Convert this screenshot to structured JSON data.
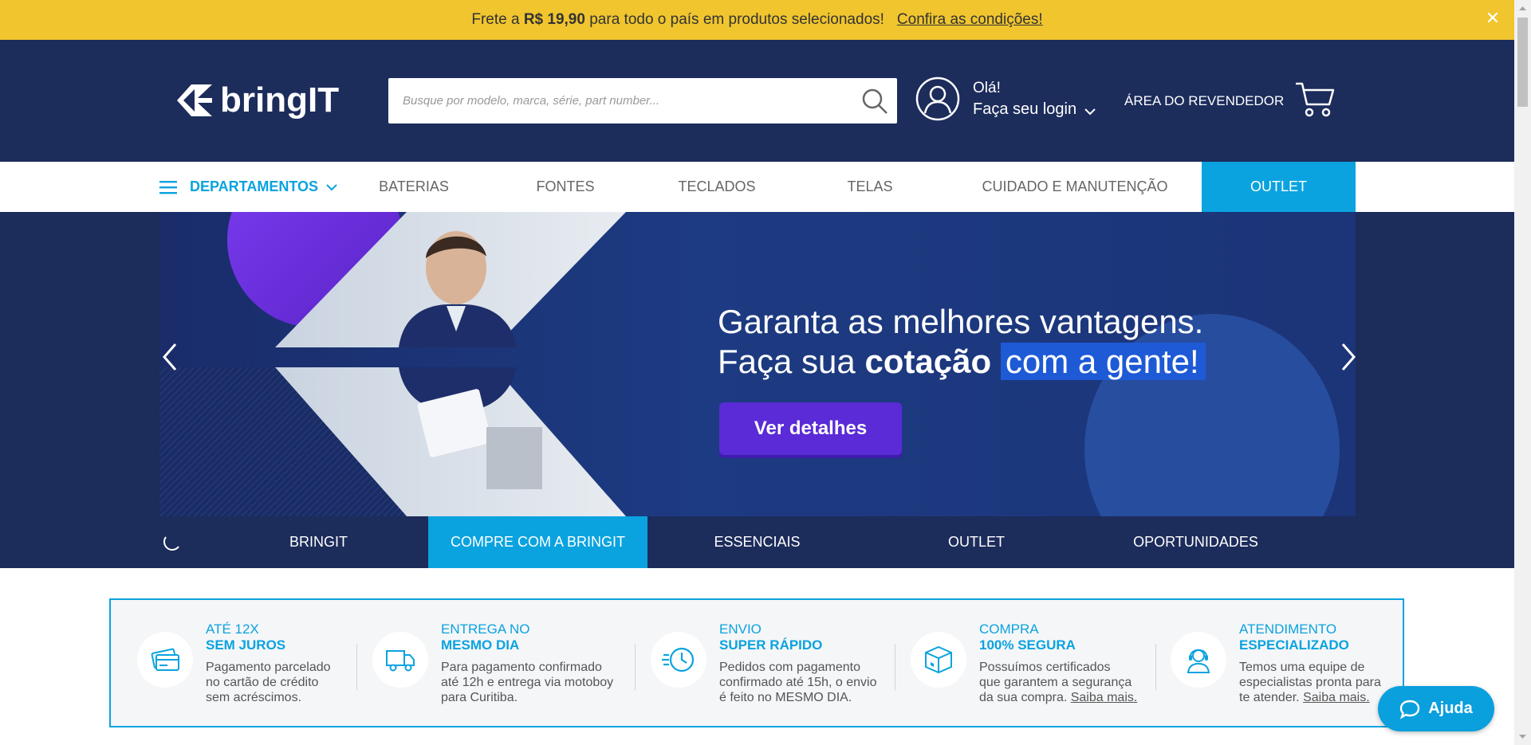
{
  "promo": {
    "text_prefix": "Frete a ",
    "price": "R$ 19,90",
    "text_suffix": " para todo o país em produtos selecionados!",
    "link": "Confira as condições!",
    "close_label": "✕"
  },
  "header": {
    "logo": "bringIT",
    "search_placeholder": "Busque por modelo, marca, série, part number...",
    "greeting": "Olá!",
    "login": "Faça seu login",
    "reseller": "ÁREA DO REVENDEDOR"
  },
  "nav": {
    "departments": "DEPARTAMENTOS",
    "items": [
      "BATERIAS",
      "FONTES",
      "TECLADOS",
      "TELAS",
      "CUIDADO E MANUTENÇÃO"
    ],
    "outlet": "OUTLET"
  },
  "hero": {
    "line1": "Garanta as melhores vantagens.",
    "line2_prefix": "Faça sua ",
    "line2_bold": "cotação",
    "line2_highlight": "com a gente!",
    "cta": "Ver detalhes"
  },
  "subnav": {
    "tabs": [
      "BRINGIT",
      "COMPRE COM A BRINGIT",
      "ESSENCIAIS",
      "OUTLET",
      "OPORTUNIDADES"
    ],
    "active_index": 1
  },
  "benefits": [
    {
      "title1": "ATÉ 12X",
      "title2": "SEM JUROS",
      "desc_lines": [
        "Pagamento parcelado",
        "no cartão de crédito",
        "sem acréscimos."
      ],
      "icon": "credit-card-icon"
    },
    {
      "title1": "ENTREGA NO",
      "title2": "MESMO DIA",
      "desc_lines": [
        "Para pagamento confirmado",
        "até 12h e entrega via motoboy",
        "para Curitiba."
      ],
      "icon": "delivery-truck-icon"
    },
    {
      "title1": "ENVIO",
      "title2": "SUPER RÁPIDO",
      "desc_lines": [
        "Pedidos com pagamento",
        "confirmado até 15h, o envio",
        "é feito no MESMO DIA."
      ],
      "icon": "fast-clock-icon"
    },
    {
      "title1": "COMPRA",
      "title2": "100% SEGURA",
      "desc_lines": [
        "Possuímos certificados",
        "que garantem a segurança",
        "da sua compra."
      ],
      "link": "Saiba mais.",
      "icon": "secure-box-icon"
    },
    {
      "title1": "ATENDIMENTO",
      "title2": "ESPECIALIZADO",
      "desc_lines": [
        "Temos uma equipe de",
        "especialistas pronta para",
        "te atender."
      ],
      "link": "Saiba mais.",
      "icon": "support-agent-icon"
    }
  ],
  "help": {
    "label": "Ajuda"
  },
  "colors": {
    "brand_navy": "#1c2c5b",
    "accent_blue": "#0aa3df",
    "promo_yellow": "#f0c52e",
    "cta_purple": "#5a2bd6"
  }
}
